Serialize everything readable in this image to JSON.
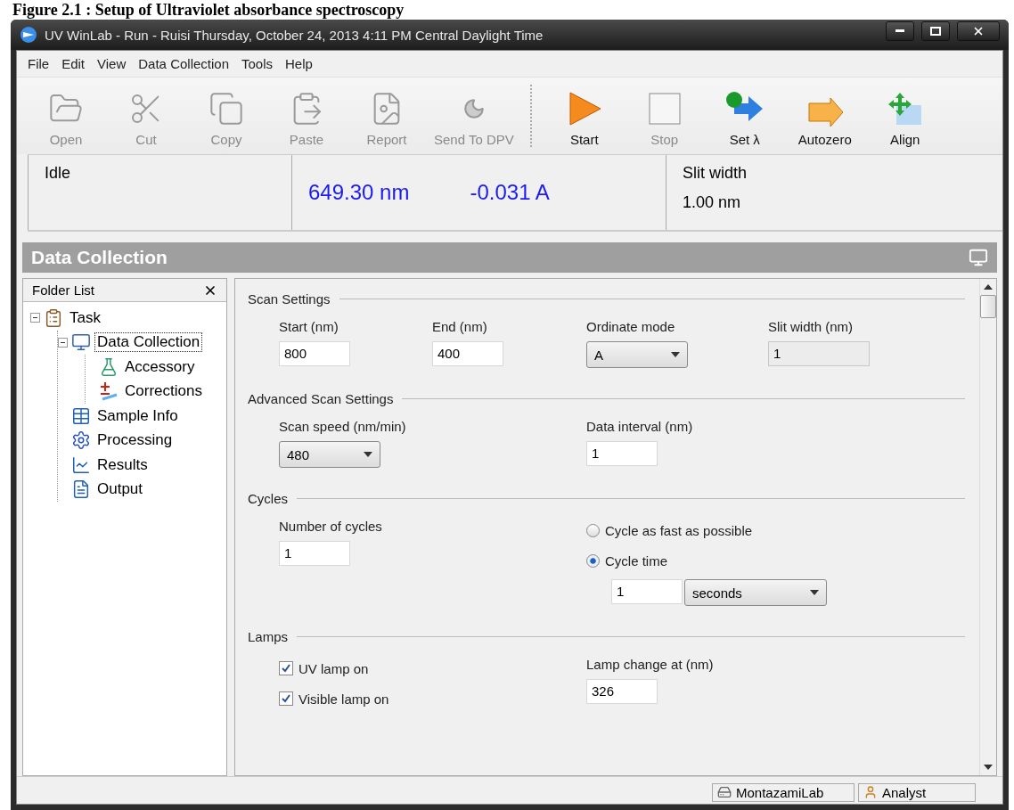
{
  "caption": "Figure 2.1 : Setup of Ultraviolet absorbance spectroscopy",
  "window": {
    "title": "UV WinLab - Run - Ruisi Thursday, October 24, 2013 4:11 PM Central Daylight Time"
  },
  "menu": [
    "File",
    "Edit",
    "View",
    "Data Collection",
    "Tools",
    "Help"
  ],
  "toolbar": [
    [
      {
        "kind": "open",
        "label": "Open",
        "disabled": true
      },
      {
        "kind": "cut",
        "label": "Cut",
        "disabled": true
      },
      {
        "kind": "copy",
        "label": "Copy",
        "disabled": true
      },
      {
        "kind": "paste",
        "label": "Paste",
        "disabled": true
      },
      {
        "kind": "report",
        "label": "Report",
        "disabled": true
      },
      {
        "kind": "send",
        "label": "Send To DPV",
        "disabled": true
      }
    ],
    [
      {
        "kind": "start",
        "label": "Start",
        "disabled": false
      },
      {
        "kind": "stop",
        "label": "Stop",
        "disabled": true
      },
      {
        "kind": "set-wavelength",
        "label": "Set λ",
        "disabled": false
      },
      {
        "kind": "autozero",
        "label": "Autozero",
        "disabled": false
      },
      {
        "kind": "align",
        "label": "Align",
        "disabled": false
      }
    ]
  ],
  "readout": {
    "state": "Idle",
    "wavelength": "649.30 nm",
    "absorbance": "-0.031 A",
    "slit_label": "Slit width",
    "slit_value": "1.00 nm"
  },
  "panel_title": "Data Collection",
  "folder_list": {
    "title": "Folder List",
    "items": [
      {
        "kind": "task",
        "label": "Task",
        "expanded": true,
        "selected": false,
        "children": [
          {
            "kind": "data-collection",
            "label": "Data Collection",
            "expanded": true,
            "selected": true,
            "children": [
              {
                "kind": "accessory",
                "label": "Accessory",
                "selected": false
              },
              {
                "kind": "corrections",
                "label": "Corrections",
                "selected": false
              }
            ]
          },
          {
            "kind": "sample-info",
            "label": "Sample Info",
            "selected": false
          },
          {
            "kind": "processing",
            "label": "Processing",
            "selected": false
          },
          {
            "kind": "results",
            "label": "Results",
            "selected": false
          },
          {
            "kind": "output",
            "label": "Output",
            "selected": false
          }
        ]
      }
    ]
  },
  "sections": [
    {
      "title": "Scan Settings",
      "columns": [
        [
          {
            "kind": "text",
            "label": "Start (nm)",
            "value": "800"
          }
        ],
        [
          {
            "kind": "text",
            "label": "End (nm)",
            "value": "400"
          }
        ],
        [
          {
            "kind": "select",
            "label": "Ordinate mode",
            "value": "A"
          }
        ],
        [
          {
            "kind": "readonly",
            "label": "Slit width (nm)",
            "value": "1"
          }
        ]
      ]
    },
    {
      "title": "Advanced Scan Settings",
      "columns": [
        [
          {
            "kind": "select",
            "label": "Scan speed (nm/min)",
            "value": "480"
          }
        ],
        [
          {
            "kind": "text",
            "label": "Data interval (nm)",
            "value": "1"
          }
        ]
      ]
    },
    {
      "title": "Cycles",
      "columns": [
        [
          {
            "kind": "text",
            "label": "Number of cycles",
            "value": "1"
          }
        ],
        [
          {
            "kind": "radio",
            "label": "Cycle as fast as possible",
            "selected": false
          },
          {
            "kind": "radio",
            "label": "Cycle time",
            "selected": true
          },
          {
            "kind": "number-unit",
            "value": "1",
            "unit": "seconds"
          }
        ]
      ]
    },
    {
      "title": "Lamps",
      "columns": [
        [
          {
            "kind": "checkbox",
            "label": "UV lamp on",
            "checked": true
          },
          {
            "kind": "checkbox",
            "label": "Visible lamp on",
            "checked": true
          }
        ],
        [
          {
            "kind": "text",
            "label": "Lamp change at (nm)",
            "value": "326"
          }
        ]
      ]
    }
  ],
  "status_bar": [
    {
      "kind": "computer",
      "label": "MontazamiLab"
    },
    {
      "kind": "user",
      "label": "Analyst"
    }
  ]
}
